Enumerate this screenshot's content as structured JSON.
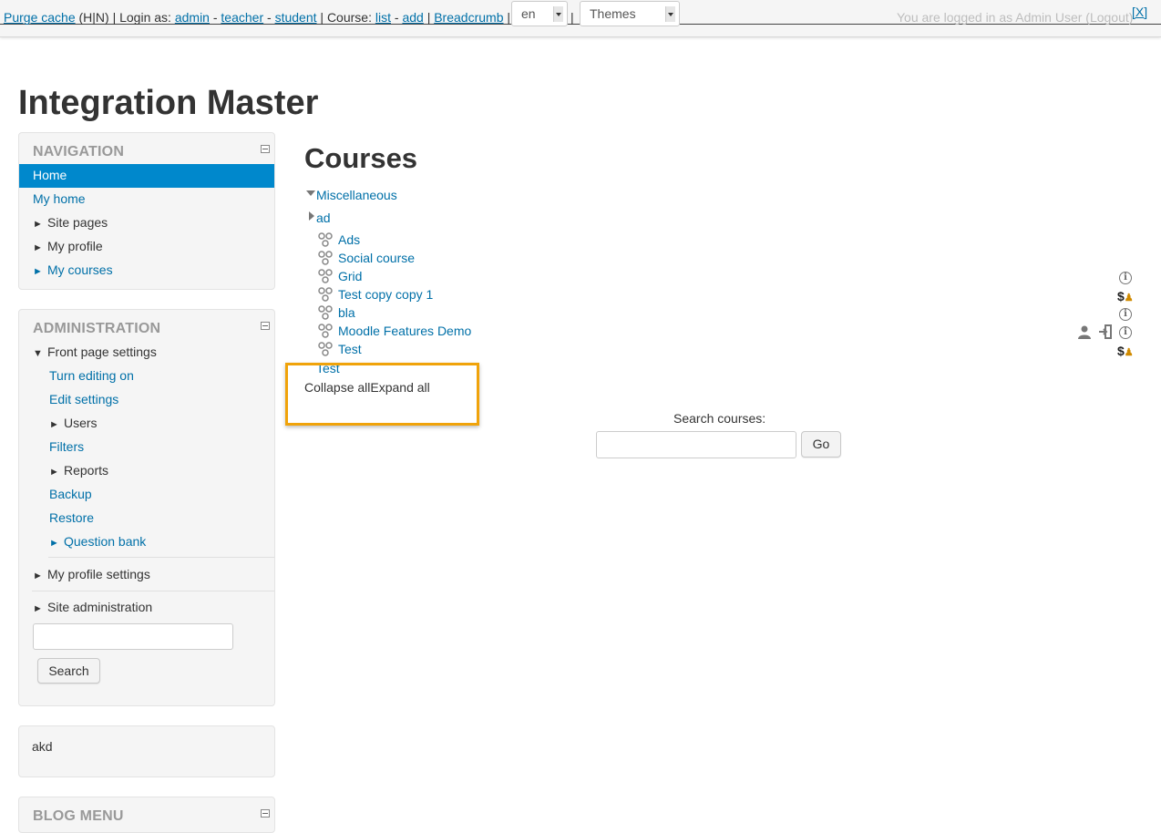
{
  "devbar": {
    "purge": "Purge cache",
    "hide_label": "(H|N)",
    "login_as": "Login as:",
    "admin": "admin",
    "teacher": "teacher",
    "student": "student",
    "course_label": "Course:",
    "list": "list",
    "add": "add",
    "breadcrumb": "Breadcrumb",
    "lang_value": "en",
    "themes_value": "Themes",
    "logged_in": "You are logged in as Admin User (Logout)",
    "close": "[X]"
  },
  "site_title": "Integration Master",
  "navigation": {
    "title": "NAVIGATION",
    "home": "Home",
    "my_home": "My home",
    "site_pages": "Site pages",
    "my_profile": "My profile",
    "my_courses": "My courses"
  },
  "administration": {
    "title": "ADMINISTRATION",
    "front_page_settings": "Front page settings",
    "turn_editing_on": "Turn editing on",
    "edit_settings": "Edit settings",
    "users": "Users",
    "filters": "Filters",
    "reports": "Reports",
    "backup": "Backup",
    "restore": "Restore",
    "question_bank": "Question bank",
    "my_profile_settings": "My profile settings",
    "site_administration": "Site administration",
    "search_button": "Search"
  },
  "text_block": {
    "content": "akd"
  },
  "blog_menu": {
    "title": "BLOG MENU"
  },
  "main": {
    "heading": "Courses",
    "category_misc": "Miscellaneous",
    "category_ad": "ad",
    "courses": [
      "Ads",
      "Social course",
      "Grid",
      "Test copy copy 1",
      "bla",
      "Moodle Features Demo",
      "Test"
    ],
    "partial_item": "Test",
    "collapse_all": "Collapse all",
    "expand_all": "Expand all",
    "search_label": "Search courses:",
    "go_button": "Go"
  },
  "colors": {
    "link": "#0070a8",
    "active_nav": "#0088cc",
    "highlight_border": "#f0a30a"
  }
}
